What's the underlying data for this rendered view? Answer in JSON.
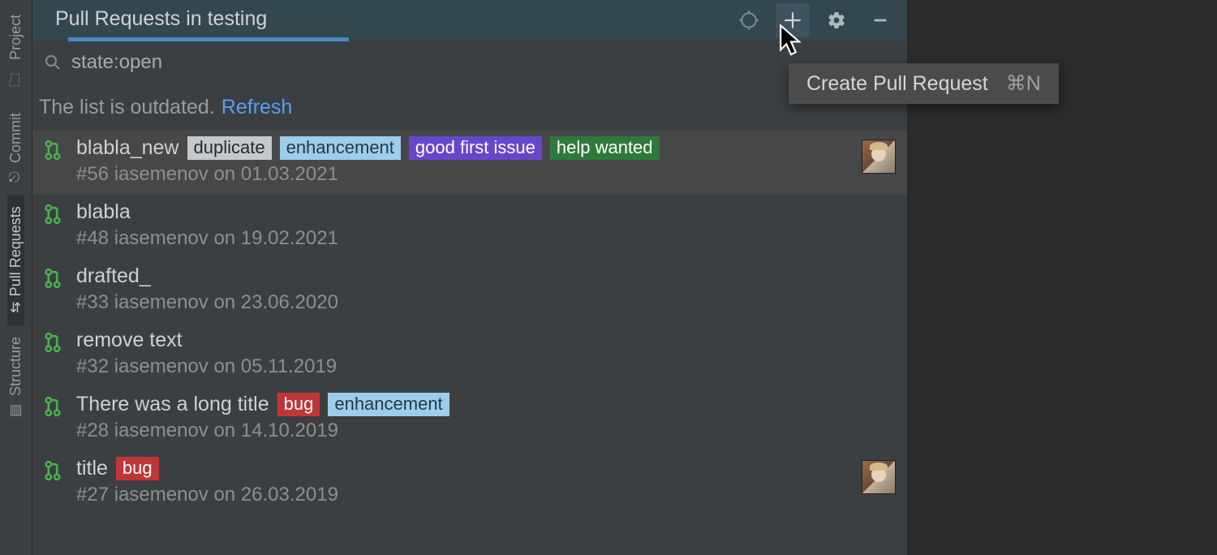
{
  "sidebar": {
    "items": [
      {
        "label": "Project",
        "icon": "folder"
      },
      {
        "label": "Commit",
        "icon": "commit"
      },
      {
        "label": "Pull Requests",
        "icon": "pr",
        "active": true
      },
      {
        "label": "Structure",
        "icon": "structure"
      }
    ]
  },
  "header": {
    "title": "Pull Requests in testing"
  },
  "search": {
    "query": "state:open"
  },
  "notice": {
    "message": "The list is outdated.",
    "link_label": "Refresh"
  },
  "tooltip": {
    "label": "Create Pull Request",
    "shortcut": "⌘N"
  },
  "label_colors": {
    "duplicate": {
      "bg": "#c6c9cc",
      "fg": "#2a2a2a"
    },
    "enhancement": {
      "bg": "#9ecdeb",
      "fg": "#1f3a4a"
    },
    "good first issue": {
      "bg": "#6647cc",
      "fg": "#ffffff"
    },
    "help wanted": {
      "bg": "#2e7a3a",
      "fg": "#ffffff"
    },
    "bug": {
      "bg": "#c03535",
      "fg": "#ffffff"
    }
  },
  "pull_requests": [
    {
      "title": "blabla_new",
      "number": "#56",
      "author": "iasemenov",
      "date": "01.03.2021",
      "labels": [
        "duplicate",
        "enhancement",
        "good first issue",
        "help wanted"
      ],
      "has_avatar": true,
      "selected": true
    },
    {
      "title": "blabla",
      "number": "#48",
      "author": "iasemenov",
      "date": "19.02.2021",
      "labels": [],
      "has_avatar": false
    },
    {
      "title": "drafted_",
      "number": "#33",
      "author": "iasemenov",
      "date": "23.06.2020",
      "labels": [],
      "has_avatar": false
    },
    {
      "title": "remove  text",
      "number": "#32",
      "author": "iasemenov",
      "date": "05.11.2019",
      "labels": [],
      "has_avatar": false
    },
    {
      "title": "There was a long title",
      "number": "#28",
      "author": "iasemenov",
      "date": "14.10.2019",
      "labels": [
        "bug",
        "enhancement"
      ],
      "has_avatar": false
    },
    {
      "title": "title",
      "number": "#27",
      "author": "iasemenov",
      "date": "26.03.2019",
      "labels": [
        "bug"
      ],
      "has_avatar": true
    }
  ]
}
